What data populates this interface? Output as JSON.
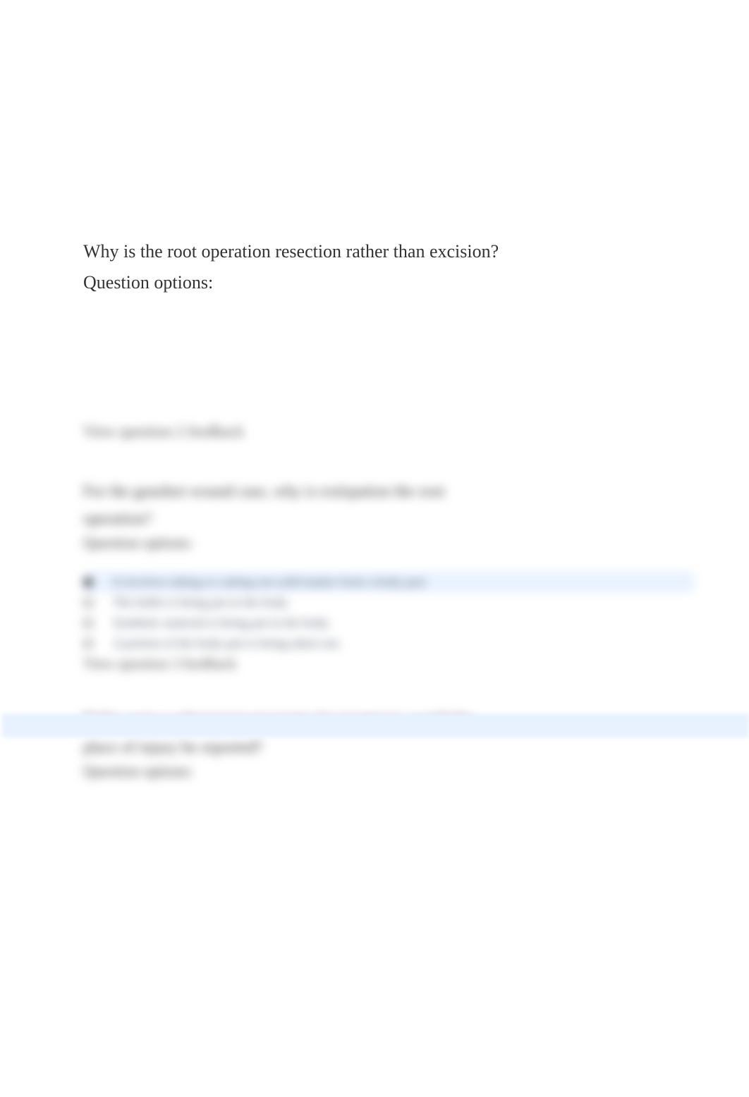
{
  "question1": {
    "text": "Why is the root operation resection rather than excision?",
    "options_label": "Question options:"
  },
  "blurred": {
    "feedback1": "View question 2 feedback",
    "question2_line1": "For the gunshot wound case, why is extirpation the root",
    "question2_line2": "operation?",
    "options_label": "Question options:",
    "options": [
      {
        "text": "It involves taking or cutting out solid matter from a body part.",
        "selected": true
      },
      {
        "text": "The bullet is being put in the body.",
        "selected": false
      },
      {
        "text": "Synthetic material is being put in the body.",
        "selected": false
      },
      {
        "text": "A portion of the body part is being taken out.",
        "selected": false
      }
    ],
    "feedback2": "View question 3 feedback",
    "question3_line1": "If this were a subsequent encounter for treatment, would the",
    "question3_line2": "place of injury be reported?",
    "options_label3": "Question options:"
  }
}
